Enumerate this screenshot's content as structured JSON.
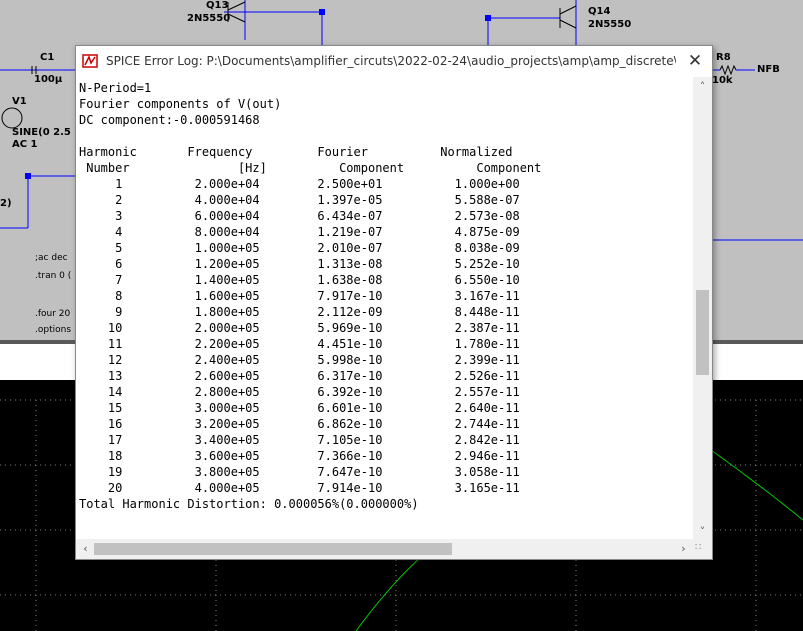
{
  "schematic": {
    "q13_label": "Q13",
    "q13_model": "2N5550",
    "q14_label": "Q14",
    "q14_model": "2N5550",
    "c1_label": "C1",
    "c1_value": "100µ",
    "v1_label": "V1",
    "v1_source": "SINE(0 2.5 2",
    "v1_ac": "AC 1",
    "r8_label": "R8",
    "r8_value": "10k",
    "nfb_label": "NFB",
    "net_2": "2)",
    "dir_ac": ";ac dec",
    "dir_tran": ".tran 0 (",
    "dir_four": ".four 20",
    "dir_options": ".options"
  },
  "dialog": {
    "title": "SPICE Error Log: P:\\Documents\\amplifier_circuts\\2022-02-24\\audio_projects\\amp\\amp_discrete\\cascoder_...",
    "close_glyph": "✕",
    "log": {
      "header_lines": [
        "N-Period=1",
        "Fourier components of V(out)",
        "DC component:-0.000591468",
        ""
      ],
      "col_headers_1": [
        "Harmonic",
        "Frequency",
        "Fourier",
        "Normalized"
      ],
      "col_headers_2": [
        "Number",
        "[Hz]",
        "Component",
        "Component"
      ],
      "rows": [
        [
          "1",
          "2.000e+04",
          "2.500e+01",
          "1.000e+00"
        ],
        [
          "2",
          "4.000e+04",
          "1.397e-05",
          "5.588e-07"
        ],
        [
          "3",
          "6.000e+04",
          "6.434e-07",
          "2.573e-08"
        ],
        [
          "4",
          "8.000e+04",
          "1.219e-07",
          "4.875e-09"
        ],
        [
          "5",
          "1.000e+05",
          "2.010e-07",
          "8.038e-09"
        ],
        [
          "6",
          "1.200e+05",
          "1.313e-08",
          "5.252e-10"
        ],
        [
          "7",
          "1.400e+05",
          "1.638e-08",
          "6.550e-10"
        ],
        [
          "8",
          "1.600e+05",
          "7.917e-10",
          "3.167e-11"
        ],
        [
          "9",
          "1.800e+05",
          "2.112e-09",
          "8.448e-11"
        ],
        [
          "10",
          "2.000e+05",
          "5.969e-10",
          "2.387e-11"
        ],
        [
          "11",
          "2.200e+05",
          "4.451e-10",
          "1.780e-11"
        ],
        [
          "12",
          "2.400e+05",
          "5.998e-10",
          "2.399e-11"
        ],
        [
          "13",
          "2.600e+05",
          "6.317e-10",
          "2.526e-11"
        ],
        [
          "14",
          "2.800e+05",
          "6.392e-10",
          "2.557e-11"
        ],
        [
          "15",
          "3.000e+05",
          "6.601e-10",
          "2.640e-11"
        ],
        [
          "16",
          "3.200e+05",
          "6.862e-10",
          "2.744e-11"
        ],
        [
          "17",
          "3.400e+05",
          "7.105e-10",
          "2.842e-11"
        ],
        [
          "18",
          "3.600e+05",
          "7.366e-10",
          "2.946e-11"
        ],
        [
          "19",
          "3.800e+05",
          "7.647e-10",
          "3.058e-11"
        ],
        [
          "20",
          "4.000e+05",
          "7.914e-10",
          "3.165e-11"
        ]
      ],
      "thd_line": "Total Harmonic Distortion: 0.000056%(0.000000%)"
    }
  },
  "colors": {
    "wire": "#0000ff",
    "trace": "#00c800",
    "plot_bg": "#000000"
  }
}
